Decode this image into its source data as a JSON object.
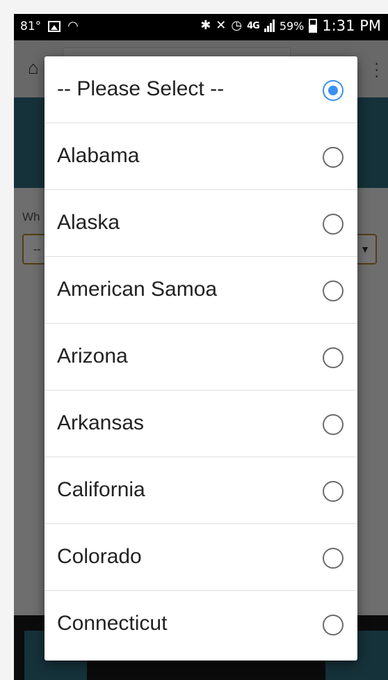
{
  "status_bar": {
    "temperature": "81°",
    "network": "4G",
    "battery_percent": "59%",
    "time": "1:31 PM"
  },
  "background_page": {
    "question_text": "Wh",
    "select_value": "--"
  },
  "dialog": {
    "options": [
      {
        "label": "-- Please Select --",
        "selected": true
      },
      {
        "label": "Alabama",
        "selected": false
      },
      {
        "label": "Alaska",
        "selected": false
      },
      {
        "label": "American Samoa",
        "selected": false
      },
      {
        "label": "Arizona",
        "selected": false
      },
      {
        "label": "Arkansas",
        "selected": false
      },
      {
        "label": "California",
        "selected": false
      },
      {
        "label": "Colorado",
        "selected": false
      },
      {
        "label": "Connecticut",
        "selected": false
      }
    ]
  },
  "colors": {
    "accent": "#3b8ff0",
    "header": "#2f6e7e",
    "select_border": "#b48a2f"
  }
}
